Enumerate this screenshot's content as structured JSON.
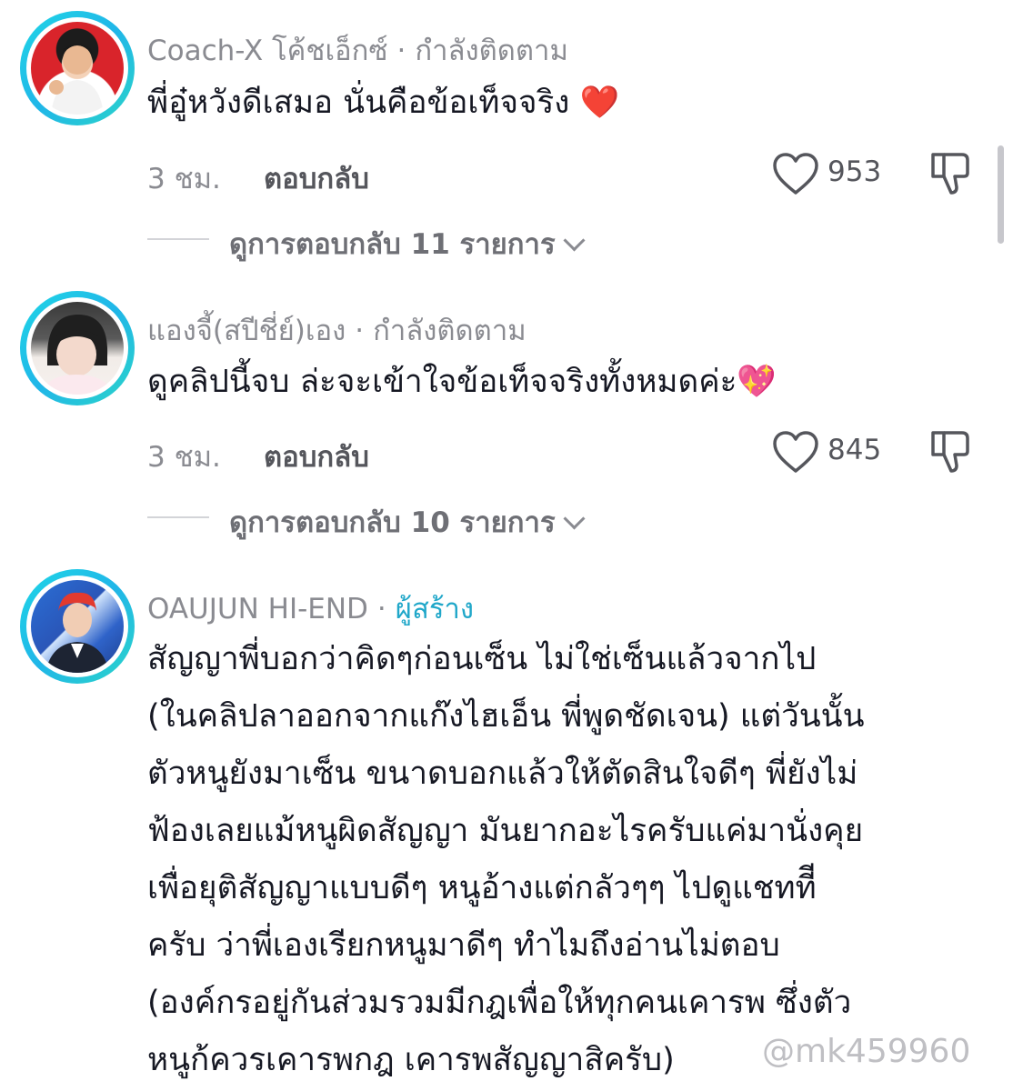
{
  "comments": [
    {
      "username": "Coach-X โค้ชเอ็กซ์",
      "relation": "กำลังติดตาม",
      "text": "พี่อู๋หวังดีเสมอ นั่นคือข้อเท็จจริง ❤️",
      "time": "3 ชม.",
      "reply_label": "ตอบกลับ",
      "likes": "953",
      "view_replies": "ดูการตอบกลับ 11 รายการ"
    },
    {
      "username": "แองจี้(สปีชี่ย์)เอง",
      "relation": "กำลังติดตาม",
      "text": "ดูคลิปนี้จบ ล่ะจะเข้าใจข้อเท็จจริงทั้งหมดค่ะ💖",
      "time": "3 ชม.",
      "reply_label": "ตอบกลับ",
      "likes": "845",
      "view_replies": "ดูการตอบกลับ 10 รายการ"
    },
    {
      "username": "OAUJUN HI-END",
      "relation": "ผู้สร้าง",
      "text_lines": [
        "สัญญาพี่บอกว่าคิดๆก่อนเซ็น ไม่ใช่เซ็นแล้วจากไป",
        "(ในคลิปลาออกจากแก๊งไฮเอ็น พี่พูดชัดเจน) แต่วันนั้น",
        "ตัวหนูยังมาเซ็น ขนาดบอกแล้วให้ตัดสินใจดีๆ พี่ยังไม่",
        "ฟ้องเลยแม้หนูผิดสัญญา มันยากอะไรครับแค่มานั่งคุย",
        "เพื่อยุติสัญญาแบบดีๆ หนูอ้างแต่กลัวๆๆ ไปดูแชททีี",
        "ครับ ว่าพี่เองเรียกหนูมาดีๆ ทำไมถึงอ่านไม่ตอบ",
        "(องค์กรอยู่กันส่วมรวมมีกฎเพื่อให้ทุกคนเคารพ ซึ่งตัว",
        "หนูก้ควรเคารพกฎ เคารพสัญญาสิครับ)"
      ]
    }
  ],
  "separator": "·",
  "watermark": "@mk459960",
  "colors": {
    "accent_ring": "#20b6e8",
    "creator": "#20a7c9",
    "muted": "#8a8b91"
  }
}
